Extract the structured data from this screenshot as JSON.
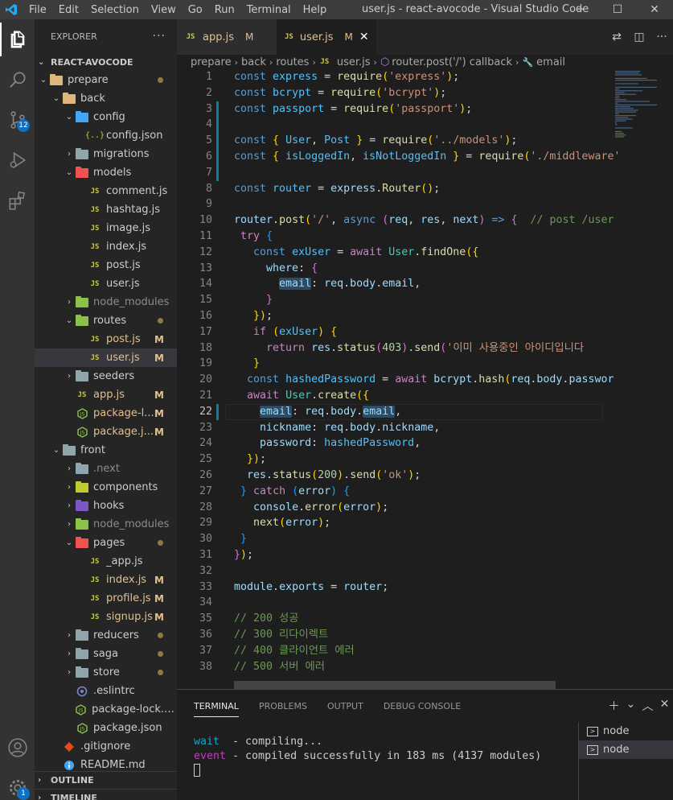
{
  "window": {
    "title": "user.js - react-avocode - Visual Studio Code",
    "menu": [
      "File",
      "Edit",
      "Selection",
      "View",
      "Go",
      "Run",
      "Terminal",
      "Help"
    ]
  },
  "activity": {
    "scm_badge": "12",
    "settings_badge": "1"
  },
  "sidebar": {
    "header": "EXPLORER",
    "more": "···",
    "root": "REACT-AVOCODE",
    "items": [
      {
        "label": "prepare",
        "kind": "folder",
        "depth": 1,
        "open": true,
        "status": "dot",
        "color": "#dcb67a"
      },
      {
        "label": "back",
        "kind": "folder",
        "depth": 2,
        "open": true,
        "status": "",
        "color": "#dcb67a"
      },
      {
        "label": "config",
        "kind": "folder",
        "depth": 3,
        "open": true,
        "status": "",
        "color": "#42a5f5"
      },
      {
        "label": "config.json",
        "kind": "json",
        "depth": 4,
        "status": ""
      },
      {
        "label": "migrations",
        "kind": "folder",
        "depth": 3,
        "open": false,
        "status": "",
        "color": "#90a4ae"
      },
      {
        "label": "models",
        "kind": "folder",
        "depth": 3,
        "open": true,
        "status": "",
        "color": "#ef5350"
      },
      {
        "label": "comment.js",
        "kind": "js",
        "depth": 4,
        "status": ""
      },
      {
        "label": "hashtag.js",
        "kind": "js",
        "depth": 4,
        "status": ""
      },
      {
        "label": "image.js",
        "kind": "js",
        "depth": 4,
        "status": ""
      },
      {
        "label": "index.js",
        "kind": "js",
        "depth": 4,
        "status": ""
      },
      {
        "label": "post.js",
        "kind": "js",
        "depth": 4,
        "status": ""
      },
      {
        "label": "user.js",
        "kind": "js",
        "depth": 4,
        "status": ""
      },
      {
        "label": "node_modules",
        "kind": "folder",
        "depth": 3,
        "open": false,
        "status": "",
        "color": "#8bc34a",
        "dim": true
      },
      {
        "label": "routes",
        "kind": "folder",
        "depth": 3,
        "open": true,
        "status": "dot",
        "color": "#8bc34a"
      },
      {
        "label": "post.js",
        "kind": "js",
        "depth": 4,
        "status": "M"
      },
      {
        "label": "user.js",
        "kind": "js",
        "depth": 4,
        "status": "M",
        "selected": true
      },
      {
        "label": "seeders",
        "kind": "folder",
        "depth": 3,
        "open": false,
        "status": "",
        "color": "#90a4ae"
      },
      {
        "label": "app.js",
        "kind": "js",
        "depth": 3,
        "status": "M"
      },
      {
        "label": "package-l...",
        "kind": "node",
        "depth": 3,
        "status": "M"
      },
      {
        "label": "package.j...",
        "kind": "node",
        "depth": 3,
        "status": "M"
      },
      {
        "label": "front",
        "kind": "folder",
        "depth": 2,
        "open": true,
        "status": "",
        "color": "#90a4ae"
      },
      {
        "label": ".next",
        "kind": "folder",
        "depth": 3,
        "open": false,
        "status": "",
        "color": "#90a4ae",
        "dim": true
      },
      {
        "label": "components",
        "kind": "folder",
        "depth": 3,
        "open": false,
        "status": "",
        "color": "#c0ca33"
      },
      {
        "label": "hooks",
        "kind": "folder",
        "depth": 3,
        "open": false,
        "status": "",
        "color": "#7e57c2"
      },
      {
        "label": "node_modules",
        "kind": "folder",
        "depth": 3,
        "open": false,
        "status": "",
        "color": "#8bc34a",
        "dim": true
      },
      {
        "label": "pages",
        "kind": "folder",
        "depth": 3,
        "open": true,
        "status": "dot",
        "color": "#ef5350"
      },
      {
        "label": "_app.js",
        "kind": "js",
        "depth": 4,
        "status": ""
      },
      {
        "label": "index.js",
        "kind": "js",
        "depth": 4,
        "status": "M"
      },
      {
        "label": "profile.js",
        "kind": "js",
        "depth": 4,
        "status": "M"
      },
      {
        "label": "signup.js",
        "kind": "js",
        "depth": 4,
        "status": "M"
      },
      {
        "label": "reducers",
        "kind": "folder",
        "depth": 3,
        "open": false,
        "status": "dot",
        "color": "#90a4ae"
      },
      {
        "label": "saga",
        "kind": "folder",
        "depth": 3,
        "open": false,
        "status": "dot",
        "color": "#90a4ae"
      },
      {
        "label": "store",
        "kind": "folder",
        "depth": 3,
        "open": false,
        "status": "dot",
        "color": "#90a4ae"
      },
      {
        "label": ".eslintrc",
        "kind": "eslint",
        "depth": 3,
        "status": ""
      },
      {
        "label": "package-lock.js...",
        "kind": "node",
        "depth": 3,
        "status": ""
      },
      {
        "label": "package.json",
        "kind": "node",
        "depth": 3,
        "status": ""
      },
      {
        "label": ".gitignore",
        "kind": "git",
        "depth": 2,
        "status": ""
      },
      {
        "label": "README.md",
        "kind": "md",
        "depth": 2,
        "status": ""
      }
    ],
    "outline": "OUTLINE",
    "timeline": "TIMELINE"
  },
  "tabs": [
    {
      "label": "app.js",
      "status": "M",
      "active": false
    },
    {
      "label": "user.js",
      "status": "M",
      "active": true,
      "close": "✕"
    }
  ],
  "breadcrumb": [
    "prepare",
    "back",
    "routes",
    "user.js",
    "router.post('/') callback",
    "email"
  ],
  "editor": {
    "current_line": 22,
    "modified_lines": [
      3,
      4,
      5,
      6,
      7,
      22
    ]
  },
  "panel": {
    "tabs": [
      "TERMINAL",
      "PROBLEMS",
      "OUTPUT",
      "DEBUG CONSOLE"
    ],
    "terminal_lines": [
      {
        "tag": "wait",
        "text": "  - compiling..."
      },
      {
        "tag": "event",
        "text": " - compiled successfully in 183 ms (4137 modules)"
      }
    ],
    "terminals": [
      "node",
      "node"
    ]
  }
}
